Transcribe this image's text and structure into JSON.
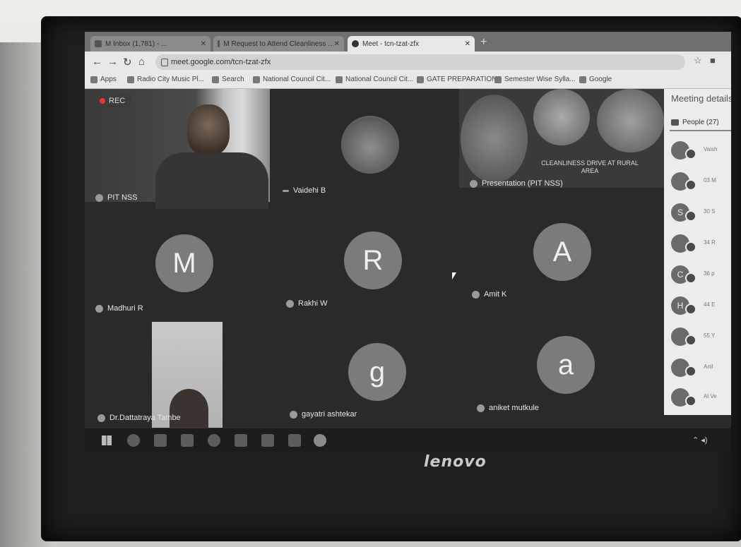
{
  "browser": {
    "tabs": [
      {
        "label": "M  Inbox (1,781) - ... ",
        "active": false
      },
      {
        "label": "M  Request to Attend Cleanliness ...",
        "active": false
      },
      {
        "label": "Meet - tcn-tzat-zfx",
        "active": true
      }
    ],
    "url": "meet.google.com/tcn-tzat-zfx",
    "bookmarks": [
      "Apps",
      "Radio City Music Pl...",
      "Search",
      "National Council Cit...",
      "National Council Cit...",
      "GATE PREPARATION",
      "Semester Wise Sylla...",
      "Google"
    ]
  },
  "meet": {
    "rec_label": "REC",
    "participants": [
      {
        "name": "PIT NSS"
      },
      {
        "name": "Vaidehi B"
      },
      {
        "name": "Presentation (PIT NSS)"
      },
      {
        "name": "Madhuri R",
        "initial": "M"
      },
      {
        "name": "Rakhi W",
        "initial": "R"
      },
      {
        "name": "Amit K",
        "initial": "A"
      },
      {
        "name": "Dr.Dattatraya Tambe"
      },
      {
        "name": "gayatri ashtekar",
        "initial": "g"
      },
      {
        "name": "aniket mutkule",
        "initial": "a"
      }
    ],
    "presentation_caption": "CLEANLINESS DRIVE AT RURAL AREA"
  },
  "panel": {
    "title": "Meeting details",
    "people_tab": "People (27)",
    "rows": [
      {
        "initial": "",
        "text": "Vaish"
      },
      {
        "initial": "",
        "text": "03 M"
      },
      {
        "initial": "S",
        "text": "30 S"
      },
      {
        "initial": "",
        "text": "34 R"
      },
      {
        "initial": "C",
        "text": "36 p"
      },
      {
        "initial": "H",
        "text": "44 E"
      },
      {
        "initial": "",
        "text": "55 Y"
      },
      {
        "initial": "",
        "text": "Anil"
      },
      {
        "initial": "",
        "text": "Al Ve"
      }
    ]
  },
  "device": {
    "brand": "lenovo"
  }
}
